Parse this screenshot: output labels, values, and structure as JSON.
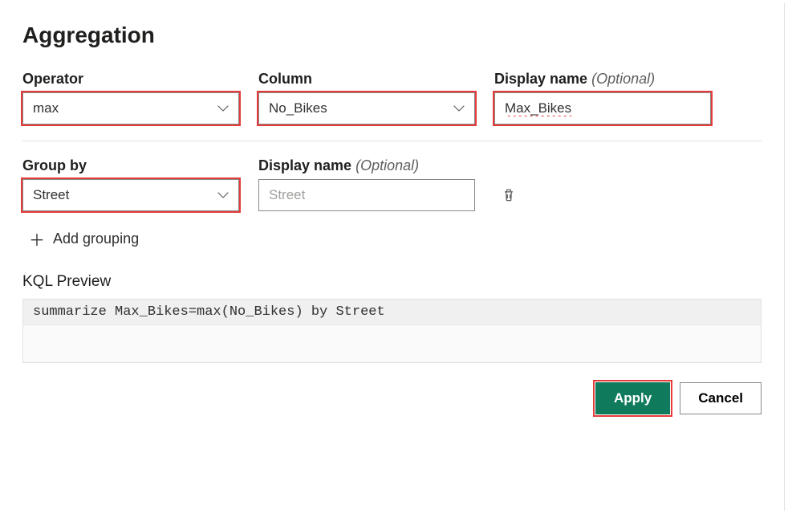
{
  "title": "Aggregation",
  "fields": {
    "operator": {
      "label": "Operator",
      "value": "max"
    },
    "column": {
      "label": "Column",
      "value": "No_Bikes"
    },
    "displayName": {
      "label": "Display name",
      "optional": "(Optional)",
      "value": "Max_Bikes"
    }
  },
  "groupBy": {
    "label": "Group by",
    "value": "Street",
    "displayName": {
      "label": "Display name",
      "optional": "(Optional)",
      "placeholder": "Street"
    }
  },
  "addGrouping": "Add grouping",
  "preview": {
    "label": "KQL Preview",
    "code": "summarize Max_Bikes=max(No_Bikes) by Street"
  },
  "buttons": {
    "apply": "Apply",
    "cancel": "Cancel"
  }
}
